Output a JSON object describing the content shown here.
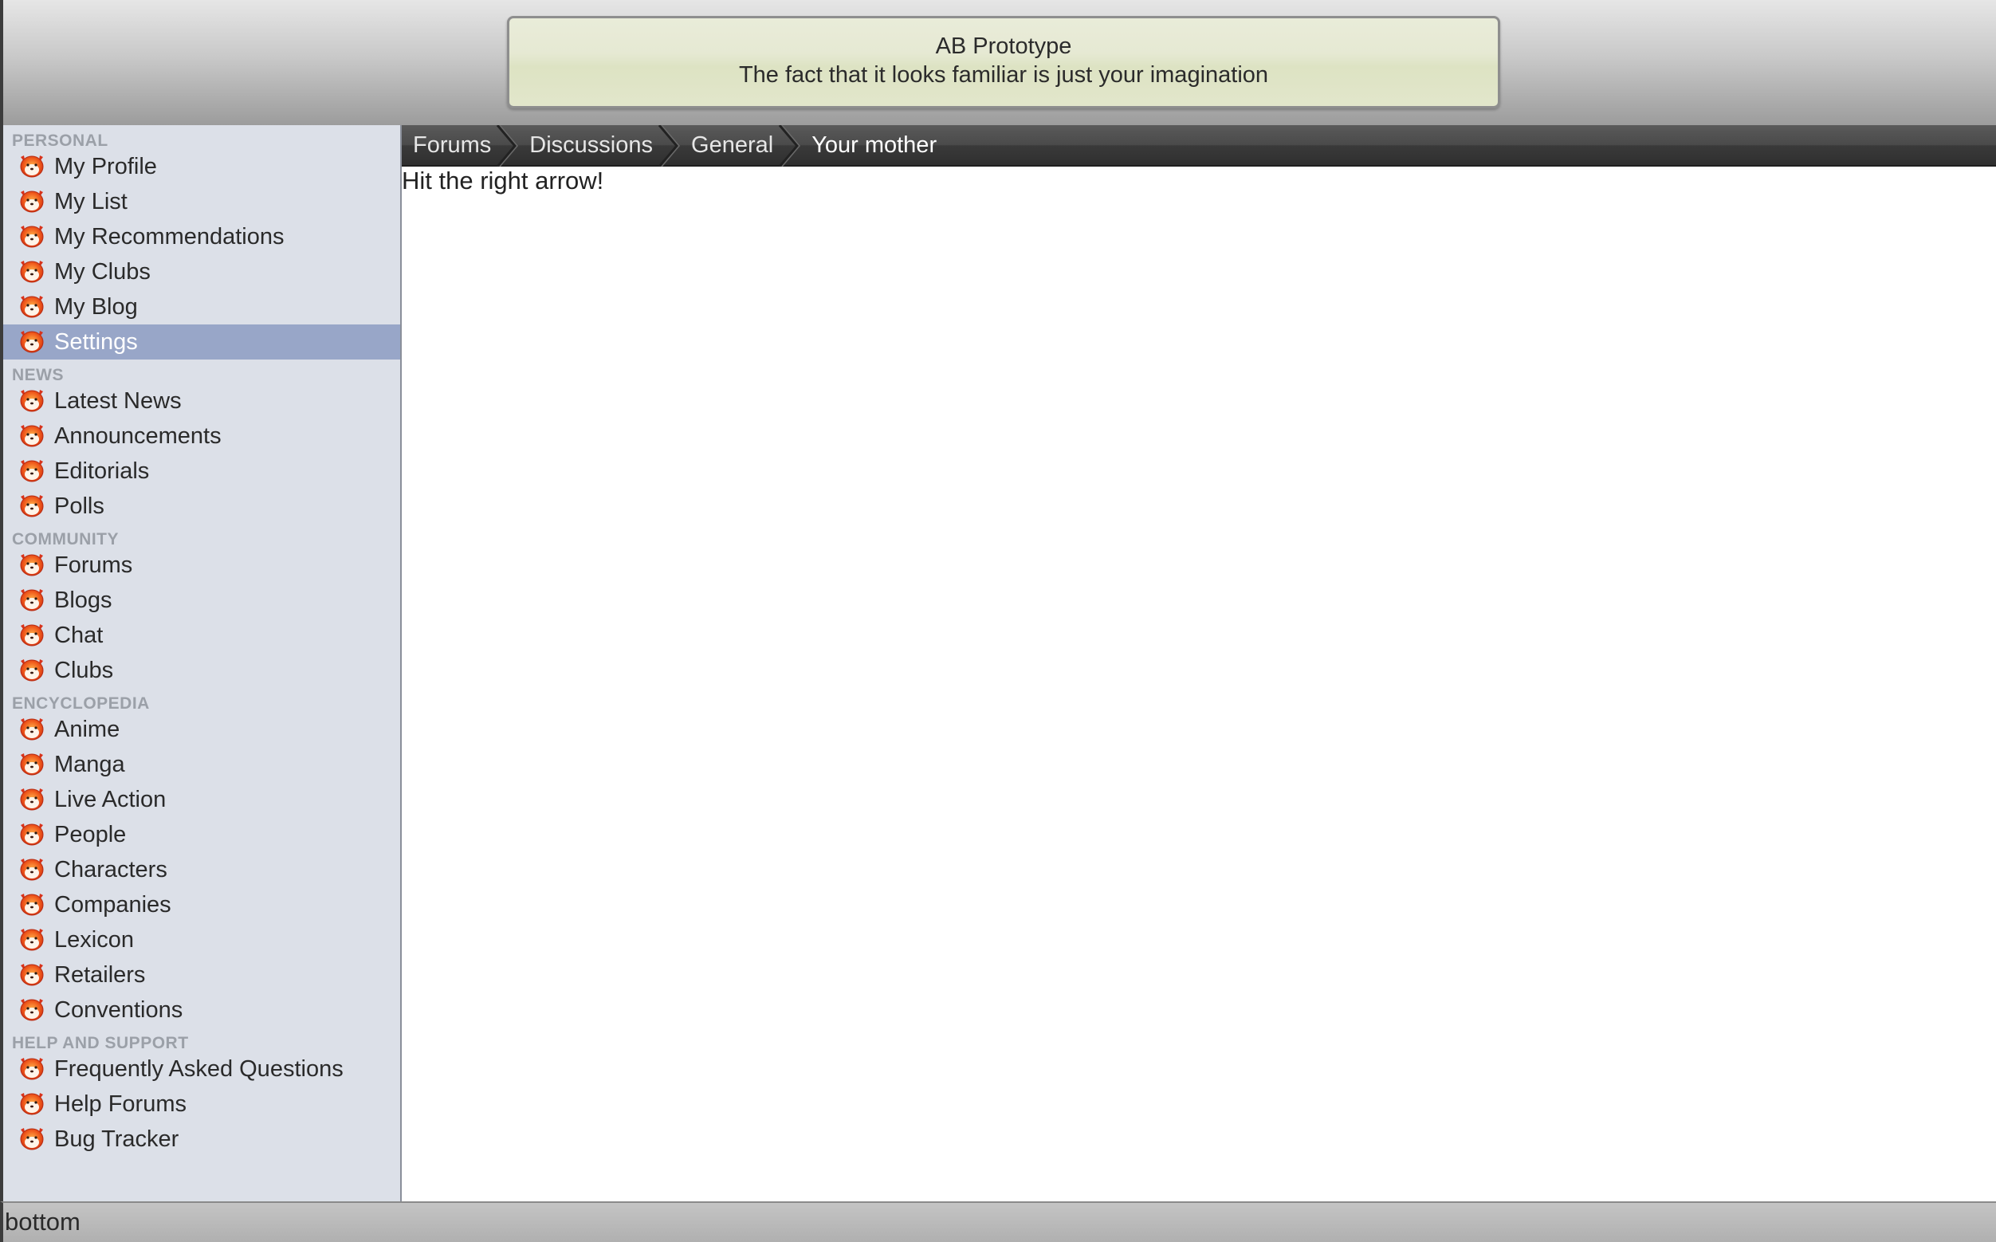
{
  "banner": {
    "title": "AB Prototype",
    "subtitle": "The fact that it looks familiar is just your imagination"
  },
  "sidebar": {
    "sections": [
      {
        "header": "PERSONAL",
        "items": [
          {
            "label": "My Profile",
            "icon": "fox-icon"
          },
          {
            "label": "My List",
            "icon": "fox-icon"
          },
          {
            "label": "My Recommendations",
            "icon": "fox-icon"
          },
          {
            "label": "My Clubs",
            "icon": "fox-icon"
          },
          {
            "label": "My Blog",
            "icon": "fox-icon"
          },
          {
            "label": "Settings",
            "icon": "fox-icon",
            "active": true
          }
        ]
      },
      {
        "header": "NEWS",
        "items": [
          {
            "label": "Latest News",
            "icon": "fox-icon"
          },
          {
            "label": "Announcements",
            "icon": "fox-icon"
          },
          {
            "label": "Editorials",
            "icon": "fox-icon"
          },
          {
            "label": "Polls",
            "icon": "fox-icon"
          }
        ]
      },
      {
        "header": "COMMUNITY",
        "items": [
          {
            "label": "Forums",
            "icon": "fox-icon"
          },
          {
            "label": "Blogs",
            "icon": "fox-icon"
          },
          {
            "label": "Chat",
            "icon": "fox-icon"
          },
          {
            "label": "Clubs",
            "icon": "fox-icon"
          }
        ]
      },
      {
        "header": "ENCYCLOPEDIA",
        "items": [
          {
            "label": "Anime",
            "icon": "fox-icon"
          },
          {
            "label": "Manga",
            "icon": "fox-icon"
          },
          {
            "label": "Live Action",
            "icon": "fox-icon"
          },
          {
            "label": "People",
            "icon": "fox-icon"
          },
          {
            "label": "Characters",
            "icon": "fox-icon"
          },
          {
            "label": "Companies",
            "icon": "fox-icon"
          },
          {
            "label": "Lexicon",
            "icon": "fox-icon"
          },
          {
            "label": "Retailers",
            "icon": "fox-icon"
          },
          {
            "label": "Conventions",
            "icon": "fox-icon"
          }
        ]
      },
      {
        "header": "HELP AND SUPPORT",
        "items": [
          {
            "label": "Frequently Asked Questions",
            "icon": "fox-icon"
          },
          {
            "label": "Help Forums",
            "icon": "fox-icon"
          },
          {
            "label": "Bug Tracker",
            "icon": "fox-icon"
          }
        ]
      }
    ]
  },
  "breadcrumb": {
    "items": [
      "Forums",
      "Discussions",
      "General",
      "Your mother"
    ]
  },
  "main": {
    "text": "Hit the right arrow!"
  },
  "footer": {
    "text": "bottom"
  },
  "colors": {
    "sidebar_bg": "#dce0e8",
    "active_item_bg": "#98a6c8",
    "section_header": "#9ba0a8",
    "icon_red": "#e2431b",
    "icon_orange": "#f08a1c"
  }
}
